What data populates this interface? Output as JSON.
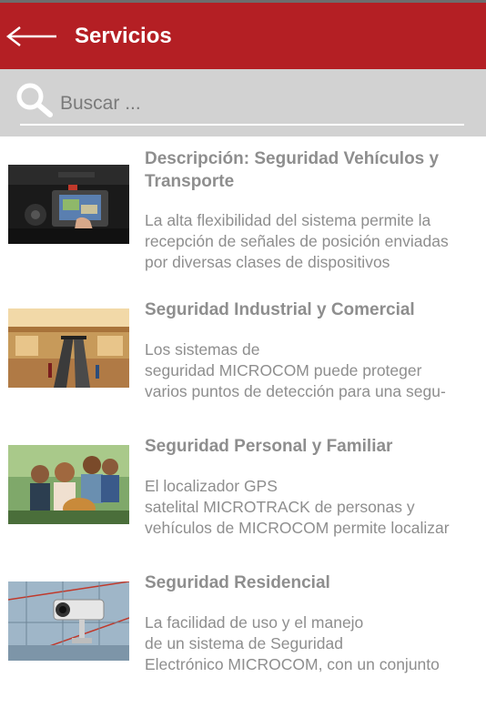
{
  "appbar": {
    "title": "Servicios",
    "color": "#b41f24"
  },
  "search": {
    "placeholder": "Buscar ..."
  },
  "services": [
    {
      "title": "Descripción: Seguridad Vehículos y Transporte",
      "description": "La alta flexibilidad del sistema permite la\nrecepción de señales de posición enviadas\npor diversas clases de dispositivos"
    },
    {
      "title": "Seguridad Industrial y Comercial",
      "description": "Los sistemas de\nseguridad MICROCOM puede proteger\nvarios puntos de detección para una segu-"
    },
    {
      "title": "Seguridad Personal y Familiar",
      "description": "El localizador GPS\nsatelital MICROTRACK de personas y\nvehículos de MICROCOM permite localizar"
    },
    {
      "title": "Seguridad Residencial",
      "description": "La facilidad de uso y el manejo\nde un sistema de Seguridad\nElectrónico MICROCOM, con un conjunto"
    }
  ]
}
